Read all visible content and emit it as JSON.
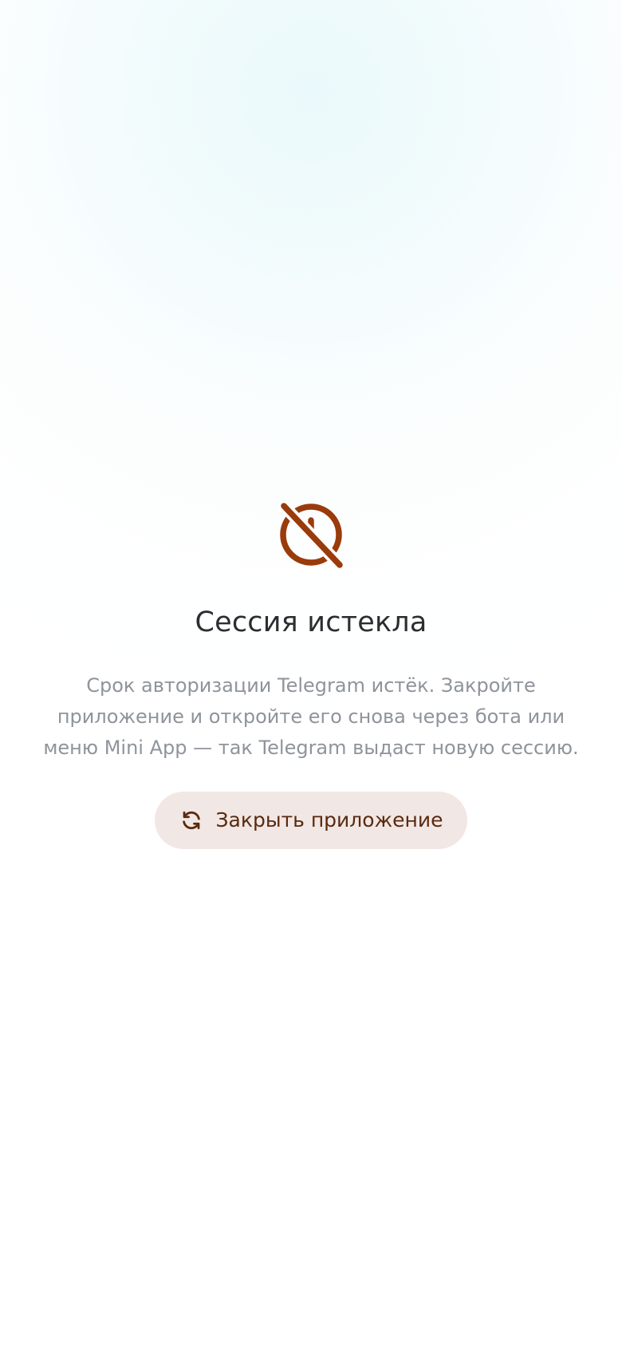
{
  "status_icon": "clock-off-icon",
  "title": "Сессия истекла",
  "description": "Срок авторизации Telegram истёк. Закройте приложение и откройте его снова через бота или меню Mini App — так Telegram выдаст новую сессию.",
  "close_button": {
    "label": "Закрыть приложение",
    "icon": "refresh-icon"
  },
  "colors": {
    "accent": "#9a3b0b",
    "button_bg": "#f1e7e5",
    "button_text": "#5a2a0e",
    "title": "#2b2d31",
    "description": "#8f949b"
  }
}
